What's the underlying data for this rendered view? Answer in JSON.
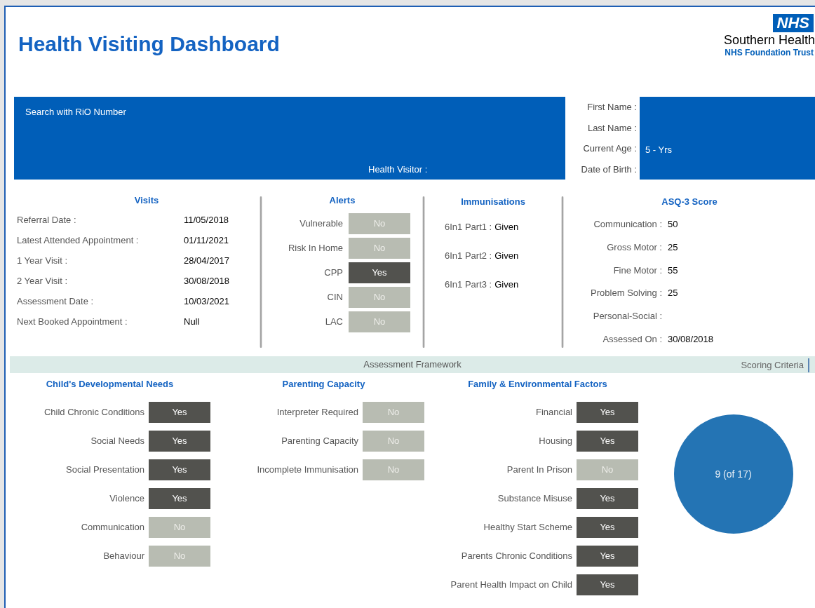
{
  "title": "Health Visiting Dashboard",
  "logo": {
    "badge": "NHS",
    "org": "Southern Health",
    "sub": "NHS Foundation Trust"
  },
  "search": {
    "label": "Search with RiO Number",
    "health_visitor_label": "Health Visitor :"
  },
  "patient": [
    {
      "label": "First Name :"
    },
    {
      "label": "Last Name :"
    },
    {
      "label": "Current Age :",
      "value": "5 - Yrs"
    },
    {
      "label": "Date of Birth :"
    }
  ],
  "visits": {
    "title": "Visits",
    "rows": [
      {
        "label": "Referral Date :",
        "value": "11/05/2018"
      },
      {
        "label": "Latest Attended Appointment :",
        "value": "01/11/2021"
      },
      {
        "label": "1 Year Visit :",
        "value": "28/04/2017"
      },
      {
        "label": "2 Year Visit :",
        "value": "30/08/2018"
      },
      {
        "label": "Assessment Date :",
        "value": "10/03/2021"
      },
      {
        "label": "Next Booked Appointment :",
        "value": "Null"
      }
    ]
  },
  "alerts": {
    "title": "Alerts",
    "rows": [
      {
        "label": "Vulnerable",
        "value": "No",
        "on": false
      },
      {
        "label": "Risk In Home",
        "value": "No",
        "on": false
      },
      {
        "label": "CPP",
        "value": "Yes",
        "on": true
      },
      {
        "label": "CIN",
        "value": "No",
        "on": false
      },
      {
        "label": "LAC",
        "value": "No",
        "on": false
      }
    ]
  },
  "immunisations": {
    "title": "Immunisations",
    "rows": [
      {
        "label": "6In1 Part1 :",
        "value": "Given"
      },
      {
        "label": "6In1 Part2 :",
        "value": "Given"
      },
      {
        "label": "6In1 Part3 :",
        "value": "Given"
      }
    ]
  },
  "asq": {
    "title": "ASQ-3 Score",
    "rows": [
      {
        "label": "Communication :",
        "value": "50"
      },
      {
        "label": "Gross Motor :",
        "value": "25"
      },
      {
        "label": "Fine Motor :",
        "value": "55"
      },
      {
        "label": "Problem Solving :",
        "value": "25"
      },
      {
        "label": "Personal-Social :"
      },
      {
        "label": "Assessed On :",
        "value": "30/08/2018"
      }
    ]
  },
  "framework": {
    "title": "Assessment Framework",
    "link": "Scoring Criteria",
    "score": "9 (of 17)",
    "columns": [
      {
        "title": "Child's Developmental Needs",
        "rows": [
          {
            "label": "Child Chronic Conditions",
            "value": "Yes",
            "on": true
          },
          {
            "label": "Social Needs",
            "value": "Yes",
            "on": true
          },
          {
            "label": "Social Presentation",
            "value": "Yes",
            "on": true
          },
          {
            "label": "Violence",
            "value": "Yes",
            "on": true
          },
          {
            "label": "Communication",
            "value": "No",
            "on": false
          },
          {
            "label": "Behaviour",
            "value": "No",
            "on": false
          }
        ]
      },
      {
        "title": "Parenting Capacity",
        "rows": [
          {
            "label": "Interpreter Required",
            "value": "No",
            "on": false
          },
          {
            "label": "Parenting Capacity",
            "value": "No",
            "on": false
          },
          {
            "label": "Incomplete Immunisation",
            "value": "No",
            "on": false
          }
        ]
      },
      {
        "title": "Family & Environmental Factors",
        "rows": [
          {
            "label": "Financial",
            "value": "Yes",
            "on": true
          },
          {
            "label": "Housing",
            "value": "Yes",
            "on": true
          },
          {
            "label": "Parent In Prison",
            "value": "No",
            "on": false
          },
          {
            "label": "Substance Misuse",
            "value": "Yes",
            "on": true
          },
          {
            "label": "Healthy Start Scheme",
            "value": "Yes",
            "on": true
          },
          {
            "label": "Parents Chronic Conditions",
            "value": "Yes",
            "on": true
          },
          {
            "label": "Parent Health Impact on Child",
            "value": "Yes",
            "on": true
          }
        ]
      }
    ]
  }
}
